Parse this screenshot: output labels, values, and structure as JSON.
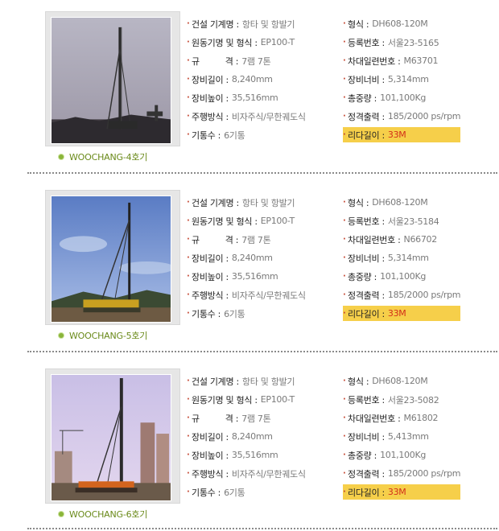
{
  "machines": [
    {
      "name": "WOOCHANG-4호기",
      "left": [
        {
          "k": "건설 기계명 :",
          "v": "항타 및 항발기"
        },
        {
          "k": "원동기명 및 형식 :",
          "v": "EP100-T"
        },
        {
          "k": "규          격 :",
          "v": "7램 7톤"
        },
        {
          "k": "장비길이 :",
          "v": "8,240mm"
        },
        {
          "k": "장비높이 :",
          "v": "35,516mm"
        },
        {
          "k": "주행방식 :",
          "v": "비자주식/무한궤도식"
        },
        {
          "k": "기통수 :",
          "v": "6기통"
        }
      ],
      "right": [
        {
          "k": "형식 :",
          "v": "DH608-120M"
        },
        {
          "k": "등록번호 :",
          "v": "서울23-5165"
        },
        {
          "k": "차대일련번호 :",
          "v": "M63701"
        },
        {
          "k": "장비너비 :",
          "v": "5,314mm"
        },
        {
          "k": "총중량 :",
          "v": "101,100Kg"
        },
        {
          "k": "정격출력 :",
          "v": "185/2000 ps/rpm"
        },
        {
          "k": "리다길이 :",
          "v": "33M"
        }
      ]
    },
    {
      "name": "WOOCHANG-5호기",
      "left": [
        {
          "k": "건설 기계명 :",
          "v": "항타 및 항발기"
        },
        {
          "k": "원동기명 및 형식 :",
          "v": "EP100-T"
        },
        {
          "k": "규          격 :",
          "v": "7램 7톤"
        },
        {
          "k": "장비길이 :",
          "v": "8,240mm"
        },
        {
          "k": "장비높이 :",
          "v": "35,516mm"
        },
        {
          "k": "주행방식 :",
          "v": "비자주식/무한궤도식"
        },
        {
          "k": "기통수 :",
          "v": "6기통"
        }
      ],
      "right": [
        {
          "k": "형식 :",
          "v": "DH608-120M"
        },
        {
          "k": "등록번호 :",
          "v": "서울23-5184"
        },
        {
          "k": "차대일련번호 :",
          "v": "N66702"
        },
        {
          "k": "장비너비 :",
          "v": "5,314mm"
        },
        {
          "k": "총중량 :",
          "v": "101,100Kg"
        },
        {
          "k": "정격출력 :",
          "v": "185/2000 ps/rpm"
        },
        {
          "k": "리다길이 :",
          "v": "33M"
        }
      ]
    },
    {
      "name": "WOOCHANG-6호기",
      "left": [
        {
          "k": "건설 기계명 :",
          "v": "항타 및 항발기"
        },
        {
          "k": "원동기명 및 형식 :",
          "v": "EP100-T"
        },
        {
          "k": "규          격 :",
          "v": "7램 7톤"
        },
        {
          "k": "장비길이 :",
          "v": "8,240mm"
        },
        {
          "k": "장비높이 :",
          "v": "35,516mm"
        },
        {
          "k": "주행방식 :",
          "v": "비자주식/무한궤도식"
        },
        {
          "k": "기통수 :",
          "v": "6기통"
        }
      ],
      "right": [
        {
          "k": "형식 :",
          "v": "DH608-120M"
        },
        {
          "k": "등록번호 :",
          "v": "서울23-5082"
        },
        {
          "k": "차대일련번호 :",
          "v": "M61802"
        },
        {
          "k": "장비너비 :",
          "v": "5,413mm"
        },
        {
          "k": "총중량 :",
          "v": "101,100Kg"
        },
        {
          "k": "정격출력 :",
          "v": "185/2000 ps/rpm"
        },
        {
          "k": "리다길이 :",
          "v": "33M"
        }
      ]
    }
  ],
  "colors": {
    "accent_green": "#6a8a1a",
    "bullet_red": "#c64a36",
    "highlight_bg": "#f6cf4a",
    "highlight_text": "#d32f1a"
  }
}
